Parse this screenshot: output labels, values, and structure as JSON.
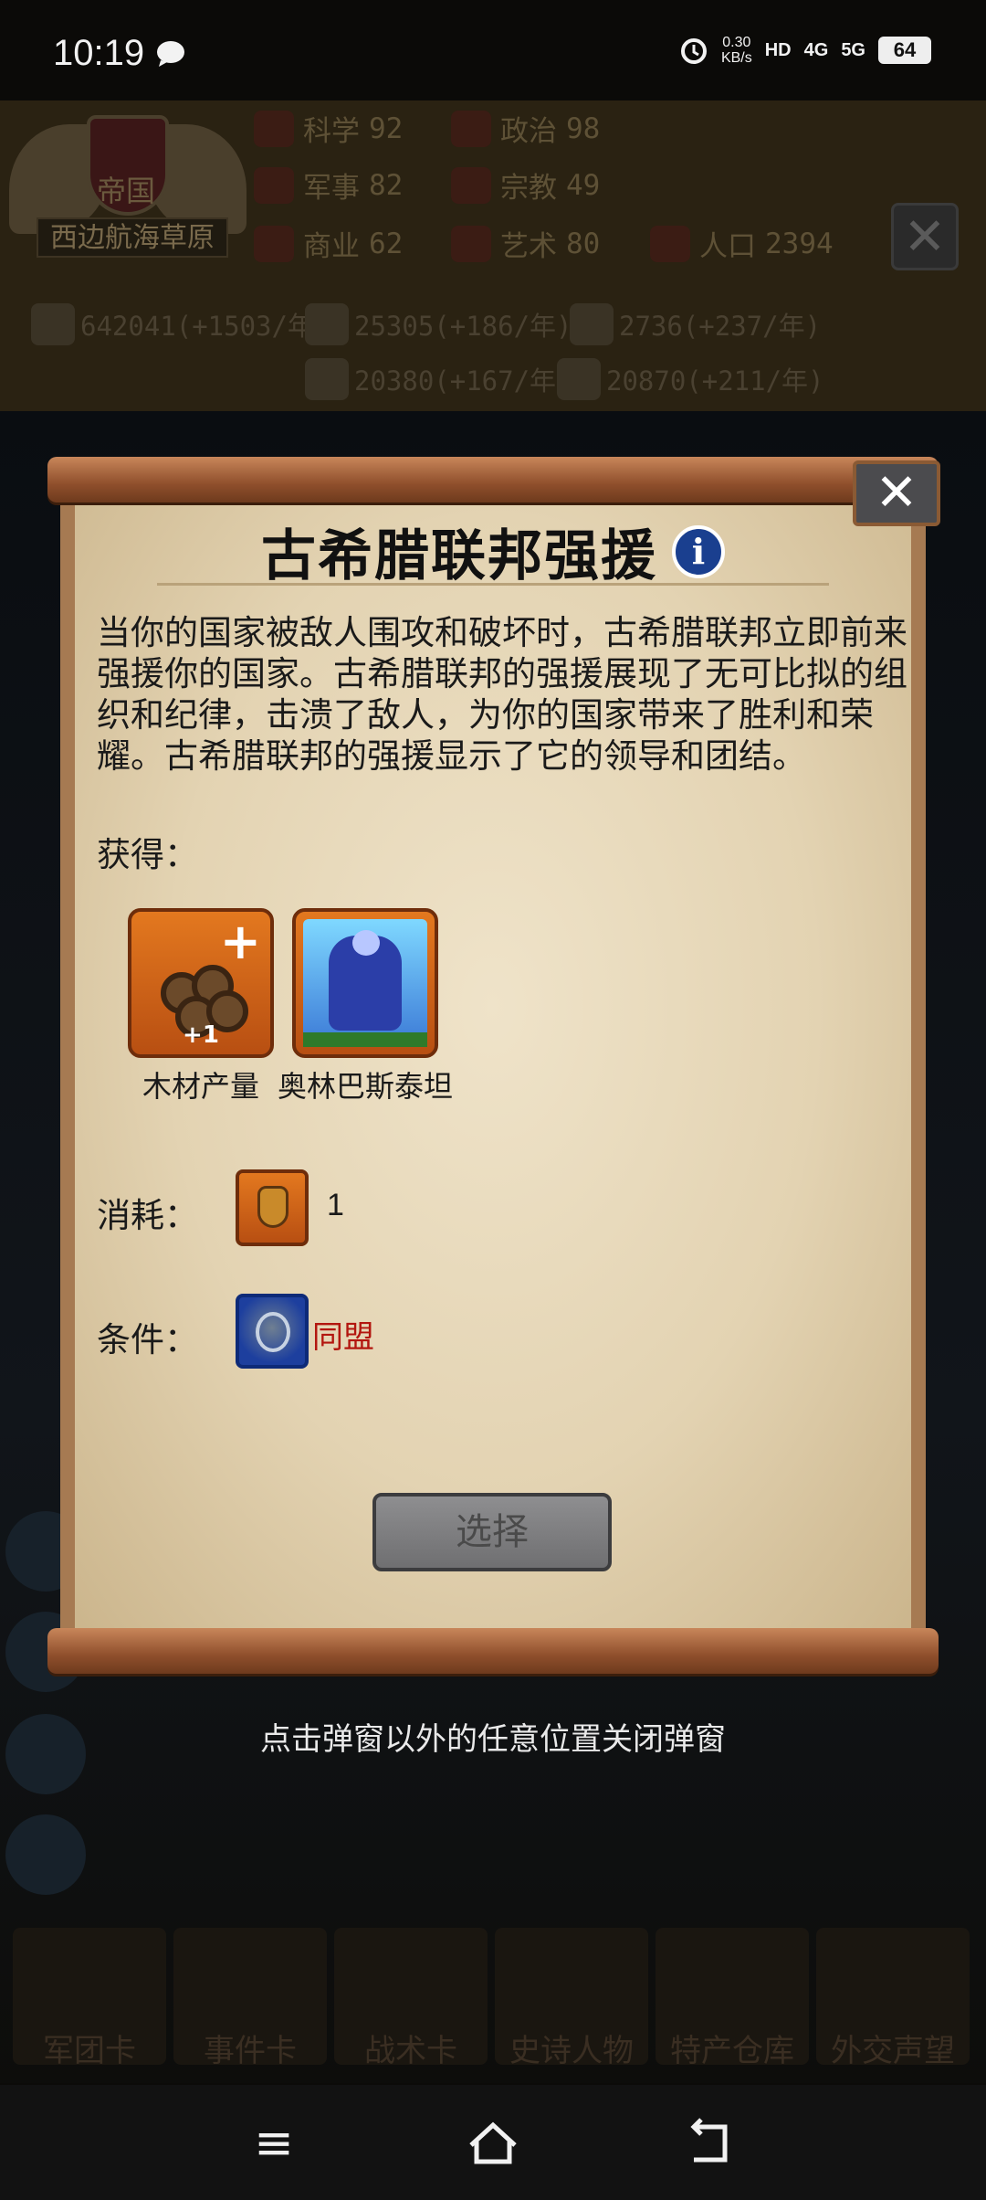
{
  "status_bar": {
    "time": "10:19",
    "net_speed_value": "0.30",
    "net_speed_unit": "KB/s",
    "hd_badge": "HD",
    "network_1": "4G",
    "network_2": "5G",
    "battery": "64"
  },
  "game_header": {
    "realm_type": "帝国",
    "realm_name": "西边航海草原",
    "stats": [
      {
        "label": "科学",
        "value": "92"
      },
      {
        "label": "政治",
        "value": "98"
      },
      {
        "label": "军事",
        "value": "82"
      },
      {
        "label": "宗教",
        "value": "49"
      },
      {
        "label": "商业",
        "value": "62"
      },
      {
        "label": "艺术",
        "value": "80"
      },
      {
        "label": "人口",
        "value": "2394"
      }
    ],
    "resources": [
      "642041(+1503/年)",
      "25305(+186/年)",
      "2736(+237/年)",
      "20380(+167/年)",
      "20870(+211/年)"
    ]
  },
  "popup": {
    "title": "古希腊联邦强援",
    "description": "当你的国家被敌人围攻和破坏时，古希腊联邦立即前来强援你的国家。古希腊联邦的强援展现了无可比拟的组织和纪律，击溃了敌人，为你的国家带来了胜利和荣耀。古希腊联邦的强援显示了它的领导和团结。",
    "gain_label": "获得：",
    "rewards": [
      {
        "name": "木材产量",
        "badge": "+1"
      },
      {
        "name": "奥林巴斯泰坦"
      }
    ],
    "cost_label": "消耗：",
    "cost_amount": "1",
    "condition_label": "条件：",
    "condition_text": "同盟",
    "select_button": "选择"
  },
  "hint": "点击弹窗以外的任意位置关闭弹窗",
  "bottom_cards": [
    "军团卡",
    "事件卡",
    "战术卡",
    "史诗人物",
    "特产仓库",
    "外交声望"
  ],
  "colors": {
    "condition_text": "#b3160f",
    "paper": "#e6d7b8",
    "scroll_rod": "#8f4f2c"
  }
}
